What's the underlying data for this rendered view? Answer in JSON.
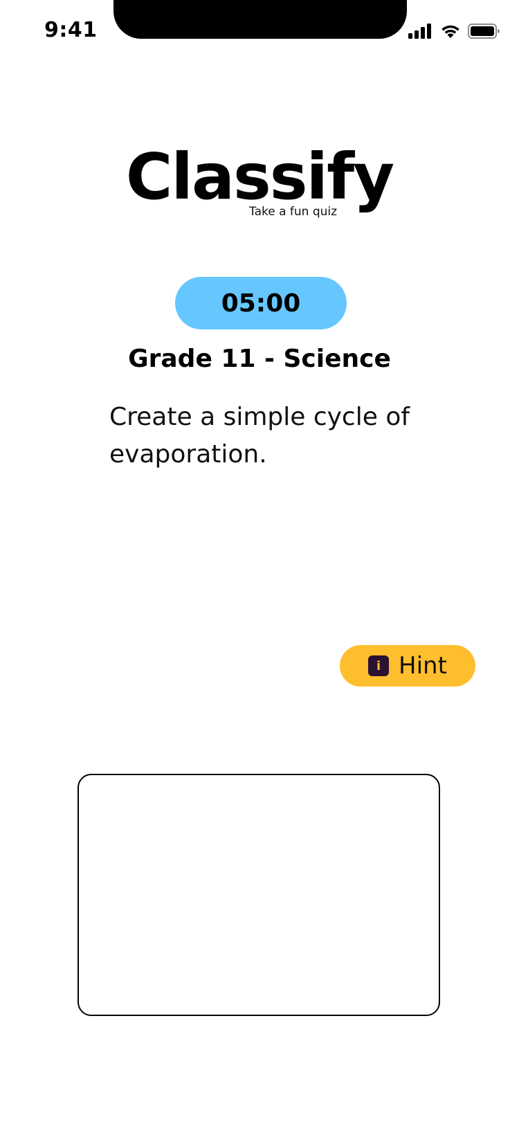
{
  "status_bar": {
    "time": "9:41",
    "icons": [
      "cellular-signal-icon",
      "wifi-icon",
      "battery-icon"
    ]
  },
  "logo": {
    "title": "Classify",
    "tagline": "Take a fun quiz"
  },
  "timer": {
    "value": "05:00",
    "color": "#66c7ff"
  },
  "quiz": {
    "title": "Grade 11 - Science",
    "question": "Create a simple cycle of evaporation."
  },
  "hint": {
    "label": "Hint",
    "icon": "info-icon",
    "icon_glyph": "i",
    "color": "#ffbe2e"
  },
  "answer": {
    "value": "",
    "placeholder": ""
  }
}
